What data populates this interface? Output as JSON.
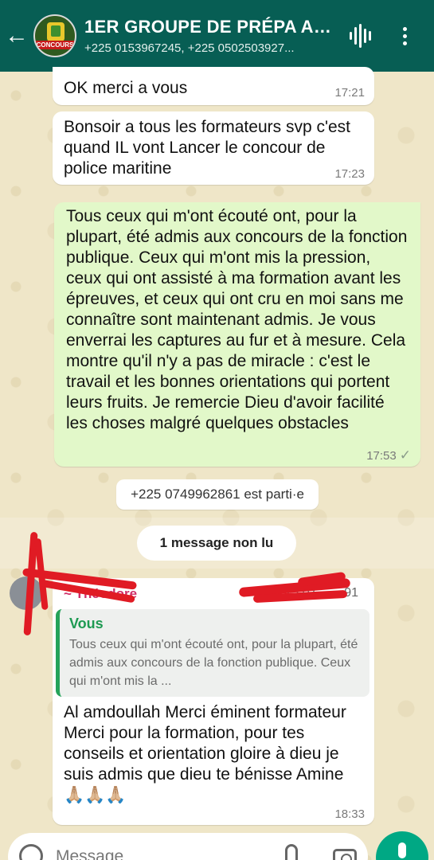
{
  "header": {
    "back_icon": "arrow-left-icon",
    "group_name": "1ER GROUPE DE PRÉPA AU...",
    "avatar_badge": "CONCOURS",
    "members": "+225 0153967245, +225 0502503927...",
    "audio_icon": "audio-wave-icon",
    "menu_icon": "more-vert-icon"
  },
  "messages": [
    {
      "text": "OK merci a vous",
      "time": "17:21"
    },
    {
      "text": "Bonsoir a tous les formateurs svp c'est quand IL vont Lancer le concour de police maritine",
      "time": "17:23"
    },
    {
      "text": "Tous ceux qui m'ont écouté ont, pour la plupart, été admis aux concours de la fonction publique. Ceux qui m'ont mis la pression, ceux qui ont assisté à ma formation avant les épreuves, et ceux qui ont cru en moi sans me connaître sont maintenant admis. Je vous enverrai les captures au fur et à mesure. Cela montre qu'il n'y a pas de miracle : c'est le travail et les bonnes orientations qui portent leurs fruits. Je remercie Dieu d'avoir facilité les choses malgré quelques obstacles",
      "time": "17:53",
      "status": "✓"
    }
  ],
  "system_notice": "+225 0749962861 est parti·e",
  "unread_banner": "1 message non lu",
  "reply": {
    "sender": "~ Théodore",
    "sender_phone": "+225 07 ·· ·· 91",
    "quote_author": "Vous",
    "quote_text": "Tous ceux qui m'ont écouté ont, pour la plupart, été admis aux concours de la fonction publique. Ceux qui m'ont mis la ...",
    "text": "Al amdoullah Merci éminent formateur Merci pour la formation, pour tes conseils et orientation gloire à dieu je suis admis  que dieu te bénisse Amine 🙏🏼🙏🏼🙏🏼",
    "time": "18:33"
  },
  "composer": {
    "placeholder": "Message",
    "emoji_icon": "emoji-icon",
    "attach_icon": "paperclip-icon",
    "camera_icon": "camera-icon",
    "mic_icon": "microphone-icon"
  },
  "colors": {
    "header": "#075e54",
    "outgoing": "#e2f8c9",
    "accent": "#00a884",
    "annotation": "#e01b24"
  }
}
